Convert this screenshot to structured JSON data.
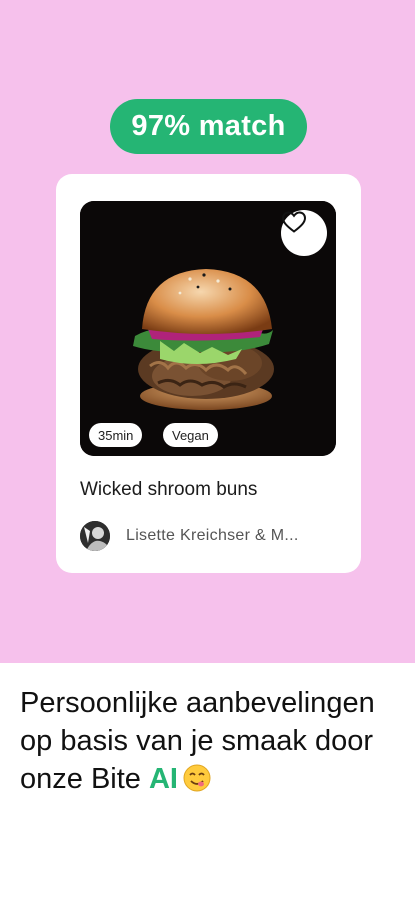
{
  "colors": {
    "background": "#f6c1ec",
    "accent": "#25b574",
    "card": "#ffffff"
  },
  "match_badge": {
    "label": "97% match"
  },
  "recipe_card": {
    "image": "burger-photo",
    "favorite_icon": "heart-outline-icon",
    "tags": [
      {
        "label": "35min"
      },
      {
        "label": "Vegan"
      }
    ],
    "title": "Wicked shroom buns",
    "author": {
      "avatar": "author-avatar",
      "name": "Lisette Kreichser & M..."
    }
  },
  "caption": {
    "text": "Persoonlijke aanbevelingen op basis van je smaak door onze Bite",
    "highlight": "AI",
    "emoji": "yum-face-emoji"
  }
}
